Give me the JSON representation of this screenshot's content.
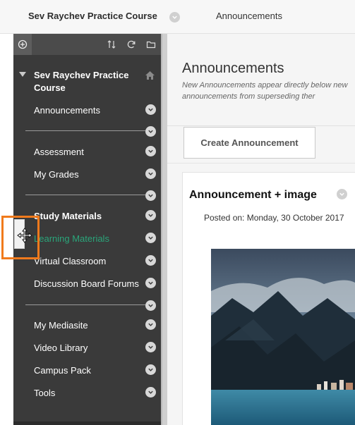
{
  "topbar": {
    "course_title": "Sev Raychev Practice Course",
    "breadcrumb": "Announcements"
  },
  "sidebar": {
    "course_title": "Sev Raychev Practice Course",
    "items": [
      {
        "label": "Announcements"
      },
      {
        "label": "Assessment"
      },
      {
        "label": "My Grades"
      },
      {
        "label": "Study Materials"
      },
      {
        "label": "Learning Materials"
      },
      {
        "label": "Virtual Classroom"
      },
      {
        "label": "Discussion Board Forums"
      },
      {
        "label": "My Mediasite"
      },
      {
        "label": "Video Library"
      },
      {
        "label": "Campus Pack"
      },
      {
        "label": "Tools"
      }
    ]
  },
  "main": {
    "title": "Announcements",
    "description": "New Announcements appear directly below new announcements from superseding ther",
    "create_button": "Create Announcement",
    "announcement": {
      "title": "Announcement + image",
      "posted": "Posted on: Monday, 30 October 2017"
    }
  },
  "colors": {
    "sidebar_bg": "#3a3a3a",
    "active_item": "#2aa57a",
    "highlight_box": "#f07a1c"
  },
  "icons": [
    "add-icon",
    "sort-icon",
    "refresh-icon",
    "folder-icon",
    "home-icon",
    "chevron-down-icon",
    "move-cursor-icon"
  ]
}
